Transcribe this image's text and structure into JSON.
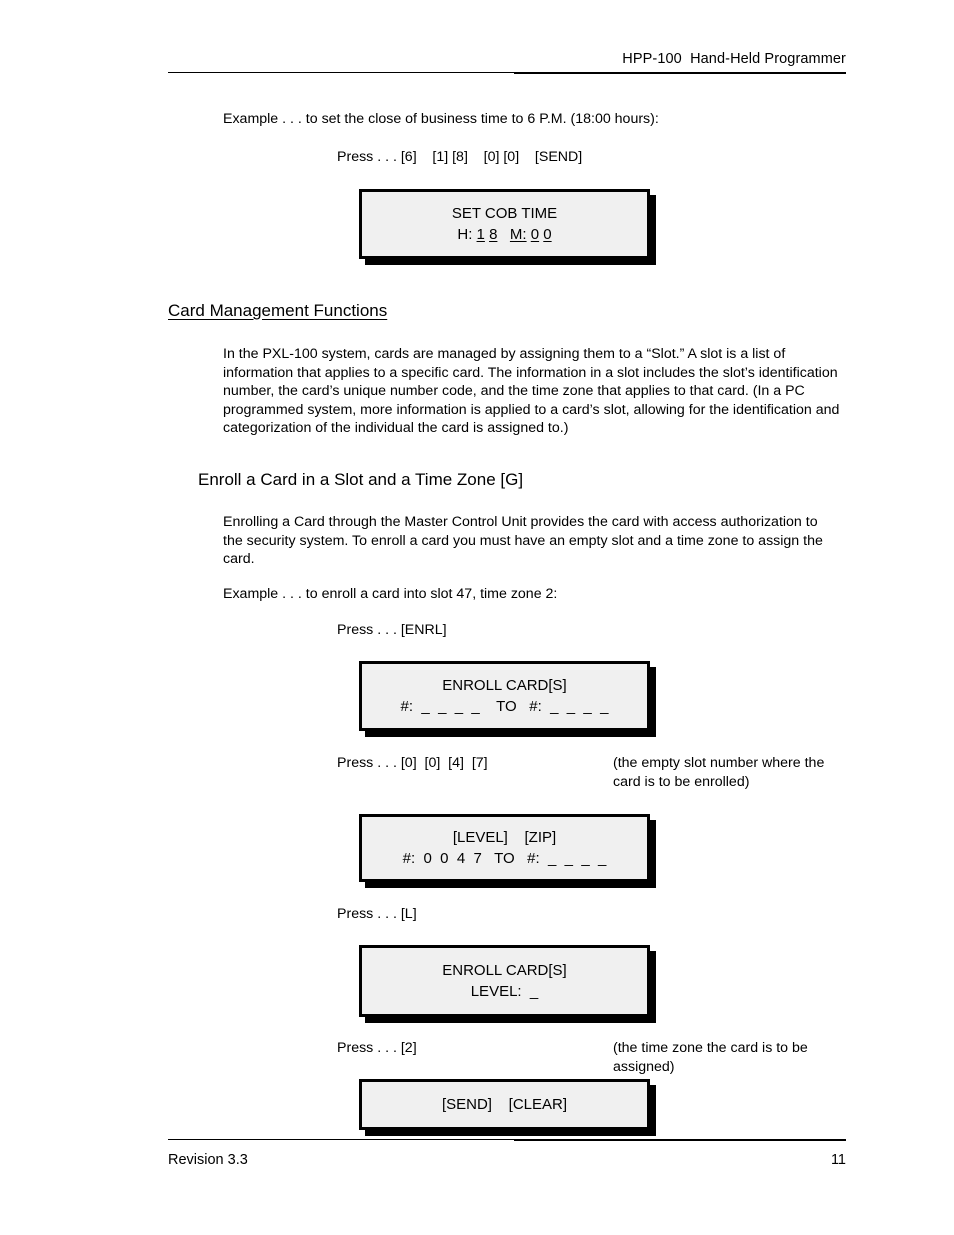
{
  "header": {
    "title": "HPP-100  Hand-Held Programmer"
  },
  "footer": {
    "revision": "Revision 3.3",
    "page_number": "11"
  },
  "content": {
    "cob_example": "Example . . . to set the close of business time to 6 P.M. (18:00 hours):",
    "cob_press": "Press . . . [6]    [1] [8]    [0] [0]    [SEND]",
    "cob_display": {
      "line1": "SET COB TIME",
      "line2_prefix": "H: ",
      "line2_h1": "1",
      "line2_h2": "8",
      "line2_gap": "   ",
      "line2_mlabel": "M:",
      "line2_m1": "0",
      "line2_m2": "0"
    },
    "card_mgmt_heading": "Card Management Functions",
    "card_mgmt_para": "In the PXL-100 system, cards are managed by assigning them to a “Slot.” A slot is a list of information that applies to a specific card. The information in a slot includes the slot’s identification number, the card’s unique number code, and the time zone that applies to that card. (In a PC programmed system, more information is applied to a card’s slot, allowing for the identification and categorization of the individual the card is assigned to.)",
    "enroll_heading": "Enroll a Card in a Slot and a Time Zone [G]",
    "enroll_para": "Enrolling a Card through the Master Control Unit provides the card with access authorization to the security system. To enroll a card you must have an empty slot and a time zone to assign the card.",
    "enroll_example": "Example . . . to enroll a card into slot 47, time zone 2:",
    "enroll_press1": "Press . . . [ENRL]",
    "enroll_display1": {
      "line1": "ENROLL CARD[S]",
      "line2": "#:  _  _  _  _    TO   #:  _  _  _  _"
    },
    "enroll_press2": "Press . . . [0]  [0]  [4]  [7]",
    "enroll_note2": "(the empty slot number where the card is to be enrolled)",
    "enroll_display2": {
      "line1": "[LEVEL]    [ZIP]",
      "line2": "#:  0  0  4  7   TO   #:  _  _  _  _"
    },
    "enroll_press3": "Press . . . [L]",
    "enroll_display3": {
      "line1": "ENROLL CARD[S]",
      "line2": "LEVEL:  _"
    },
    "enroll_press4": "Press . . . [2]",
    "enroll_note4": "(the time zone the card is to be assigned)",
    "enroll_display4": {
      "line1": "[SEND]    [CLEAR]"
    }
  }
}
